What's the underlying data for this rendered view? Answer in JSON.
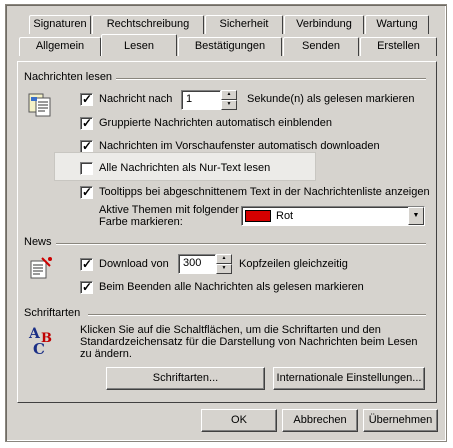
{
  "tabs_row1": [
    {
      "label": "Signaturen"
    },
    {
      "label": "Rechtschreibung"
    },
    {
      "label": "Sicherheit"
    },
    {
      "label": "Verbindung"
    },
    {
      "label": "Wartung"
    }
  ],
  "tabs_row2": [
    {
      "label": "Allgemein"
    },
    {
      "label": "Lesen",
      "active": true
    },
    {
      "label": "Bestätigungen"
    },
    {
      "label": "Senden"
    },
    {
      "label": "Erstellen"
    }
  ],
  "read": {
    "heading": "Nachrichten lesen",
    "mark_read_prefix": "Nachricht nach",
    "mark_read_seconds": "1",
    "mark_read_suffix": "Sekunde(n) als gelesen markieren",
    "grouped": "Gruppierte Nachrichten automatisch einblenden",
    "preview_download": "Nachrichten im Vorschaufenster automatisch downloaden",
    "plain_text": "Alle Nachrichten als Nur-Text lesen",
    "tooltips": "Tooltipps bei abgeschnittenem Text in der Nachrichtenliste anzeigen",
    "color_label_1": "Aktive Themen mit folgender",
    "color_label_2": "Farbe markieren:",
    "color_value": "Rot",
    "color_swatch": "#d40000"
  },
  "news": {
    "heading": "News",
    "download_prefix": "Download von",
    "download_count": "300",
    "download_suffix": "Kopfzeilen gleichzeitig",
    "mark_on_exit": "Beim Beenden alle Nachrichten als gelesen markieren"
  },
  "fonts": {
    "heading": "Schriftarten",
    "desc_1": "Klicken Sie auf die Schaltflächen, um die Schriftarten und den",
    "desc_2": "Standardzeichensatz für die Darstellung von Nachrichten beim Lesen",
    "desc_3": "zu ändern.",
    "fonts_button": "Schriftarten...",
    "intl_button": "Internationale Einstellungen..."
  },
  "footer": {
    "ok": "OK",
    "cancel": "Abbrechen",
    "apply": "Übernehmen"
  },
  "icons": {
    "read": "message-read-icon",
    "news": "newsgroup-icon",
    "fonts": "fonts-abc-icon"
  }
}
